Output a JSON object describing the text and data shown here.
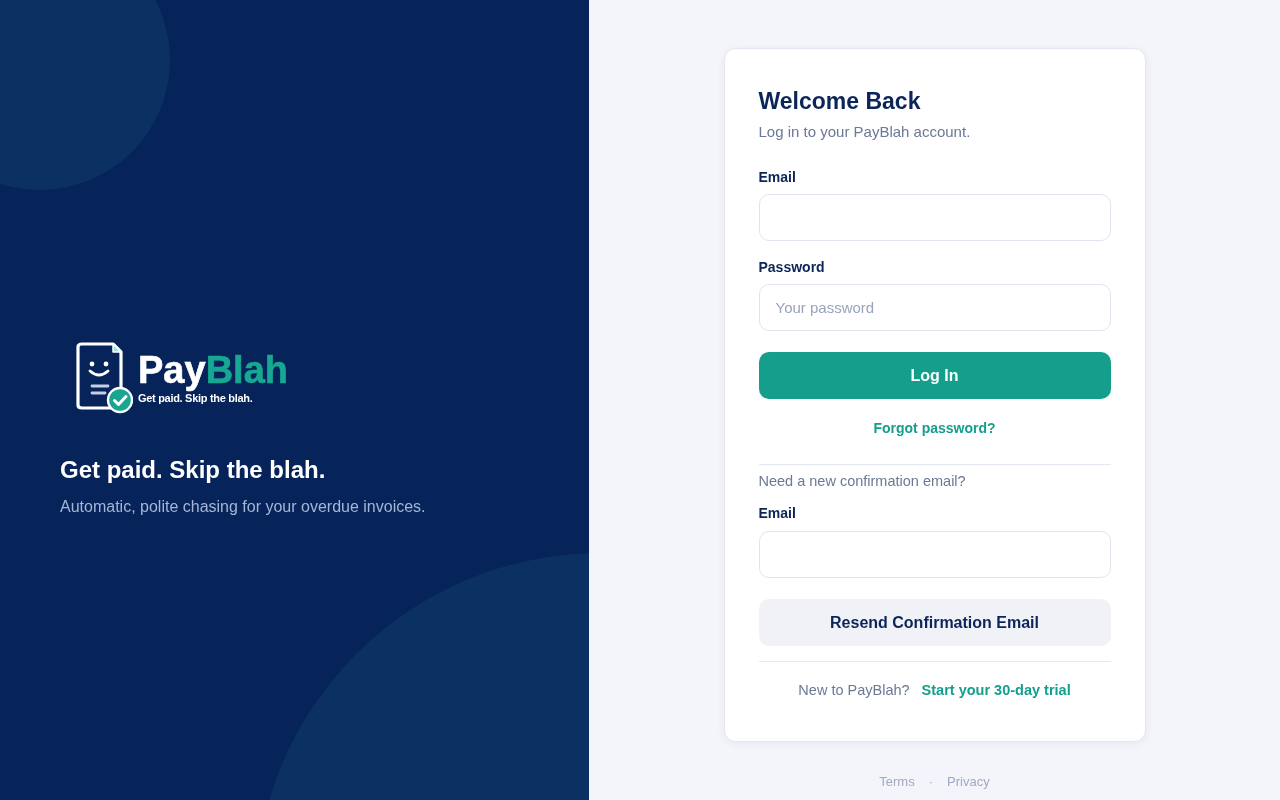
{
  "brand_panel": {
    "logo": {
      "wordmark": [
        {
          "text": "Pay",
          "accent": false
        },
        {
          "text": "Blah",
          "accent": true
        }
      ],
      "tagline": "Get paid. Skip the blah."
    },
    "headline": "Get paid. Skip the blah.",
    "description": "Automatic, polite chasing for your overdue invoices."
  },
  "login_card": {
    "title": "Welcome Back",
    "subtitle": "Log in to your PayBlah account.",
    "fields": [
      {
        "label": "Email"
      },
      {
        "label": "Password",
        "placeholder": "Your password"
      }
    ],
    "login_button": "Log In",
    "forgot_password_link": "Forgot password?",
    "resend": {
      "prompt": "Need a new confirmation email?",
      "field": {
        "label": "Email"
      },
      "button": "Resend Confirmation Email"
    },
    "signup": {
      "prompt": "New to PayBlah?",
      "link": "Start your 30-day trial"
    }
  },
  "footer": {
    "links": [
      "Terms",
      "Privacy"
    ],
    "separator": "·"
  }
}
